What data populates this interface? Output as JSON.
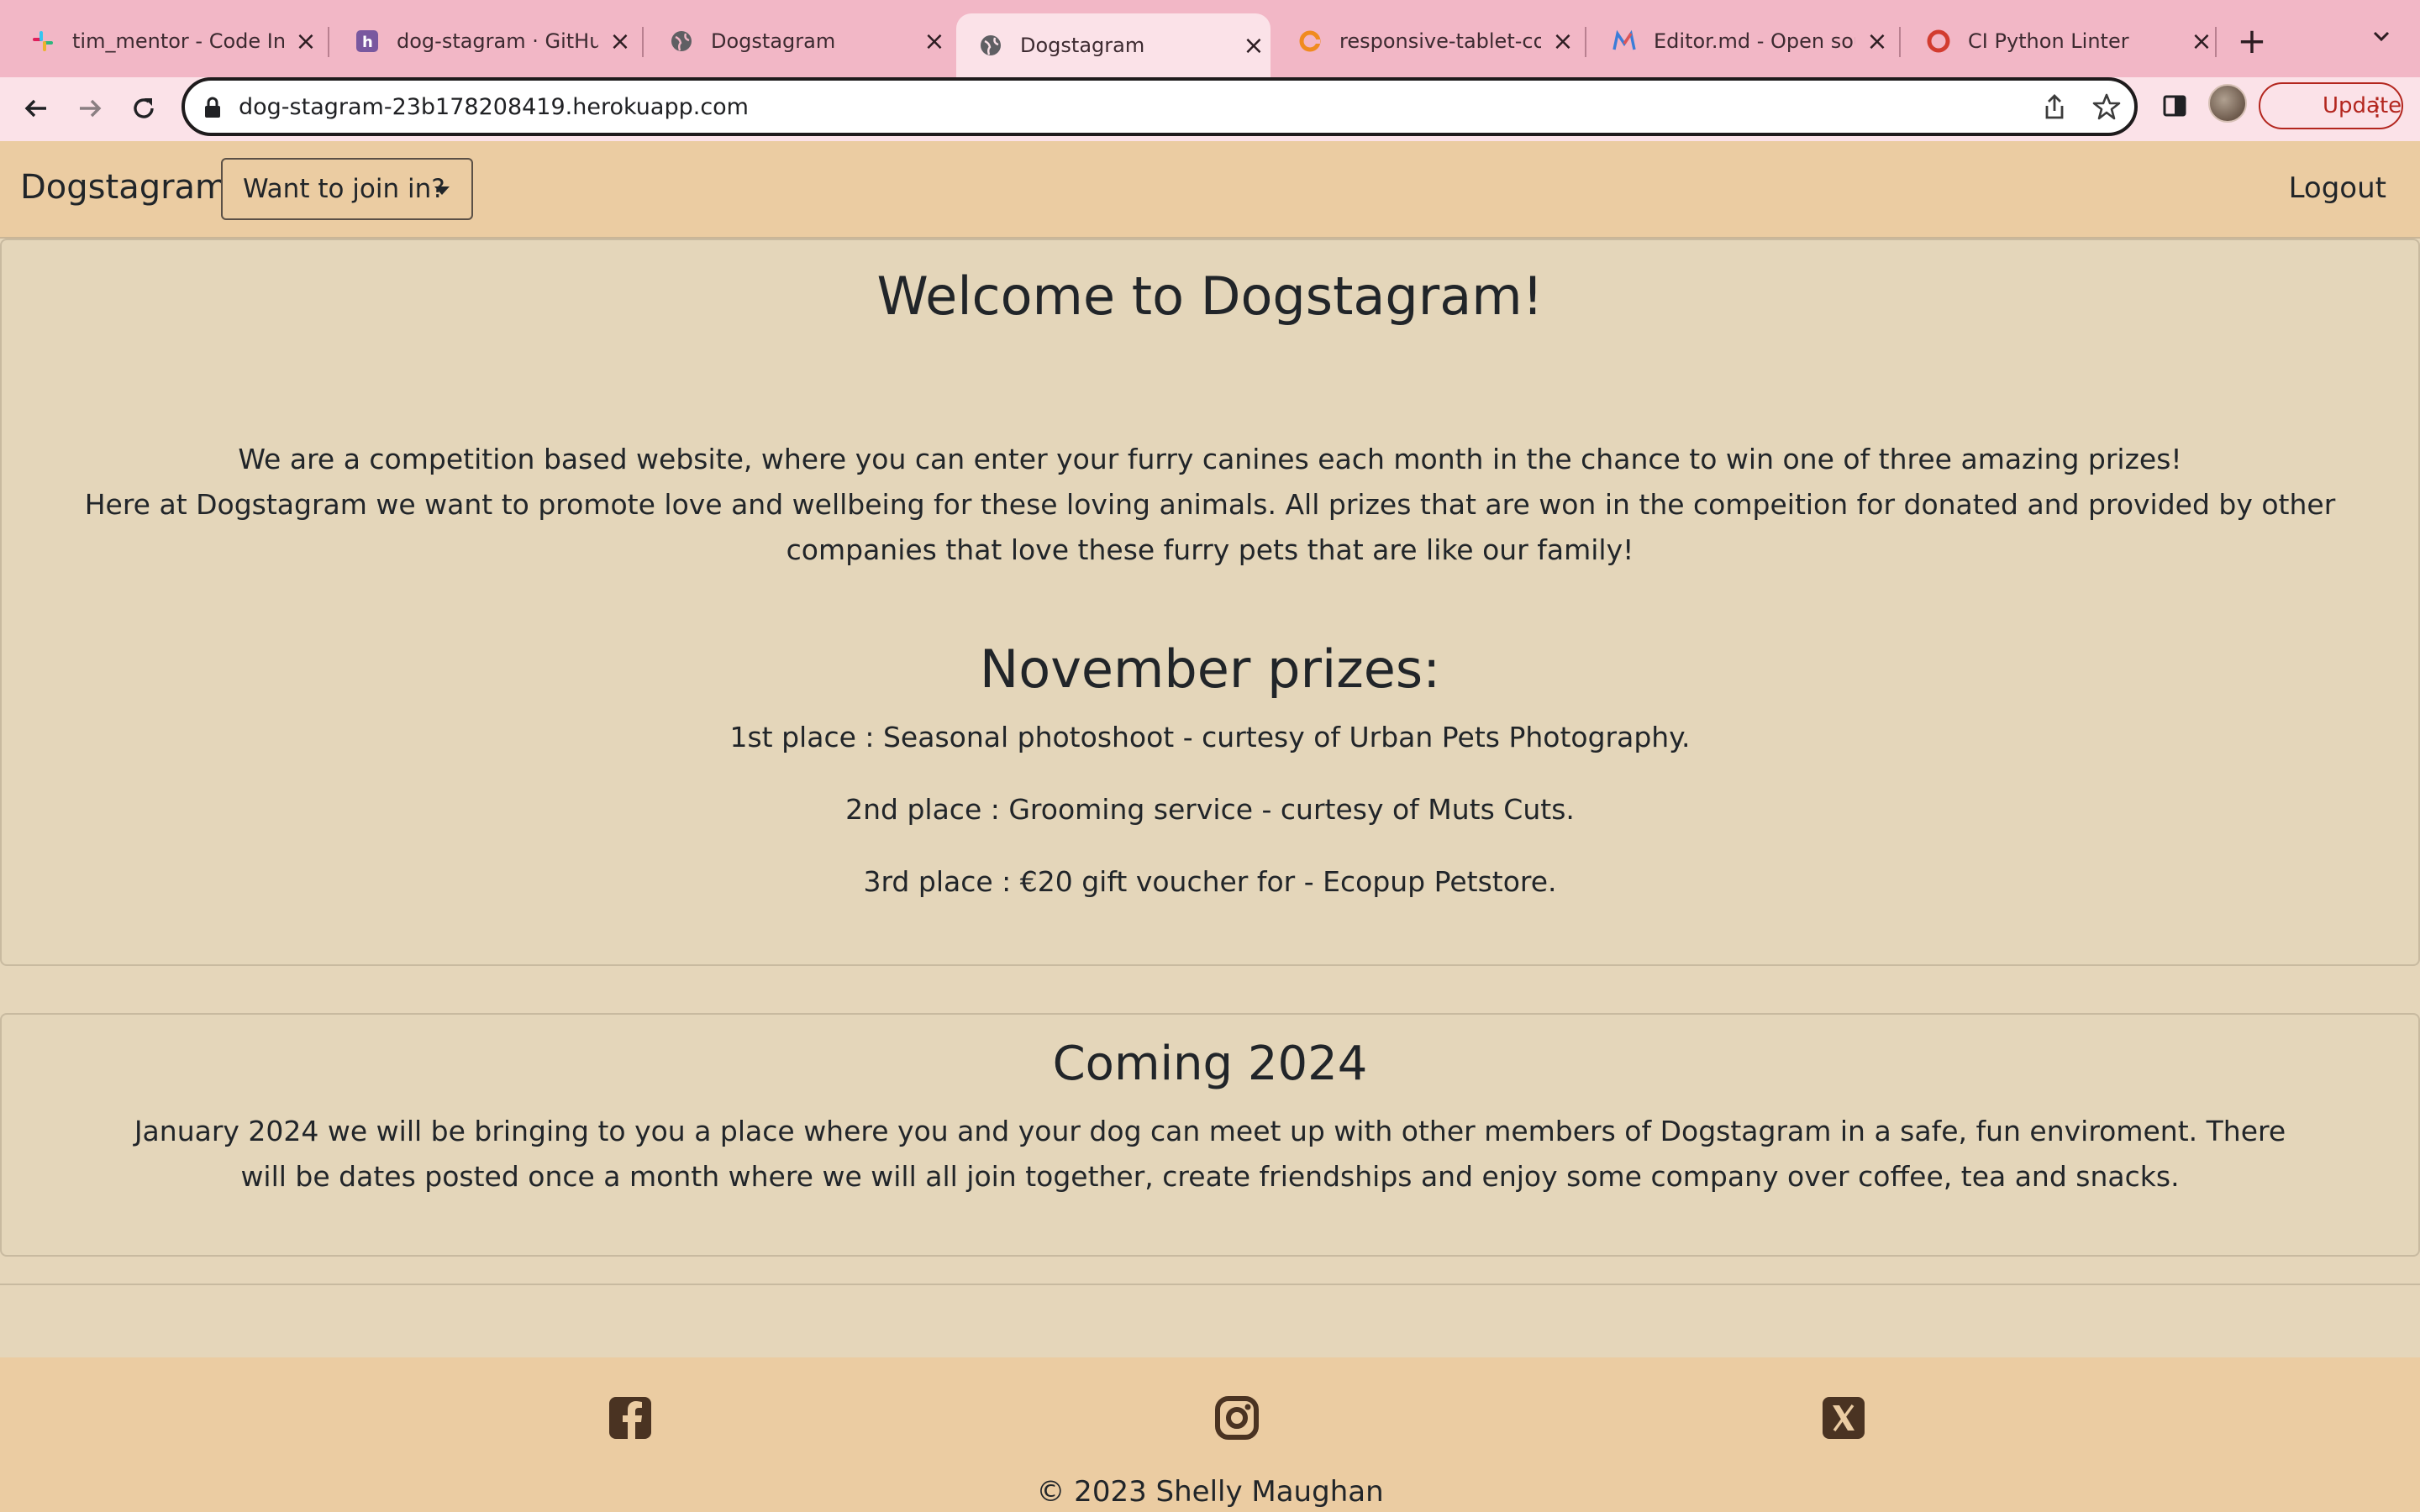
{
  "browser": {
    "tabs": [
      {
        "title": "tim_mentor - Code In",
        "favicon": "slack-icon"
      },
      {
        "title": "dog-stagram · GitHub",
        "favicon": "heroku-icon"
      },
      {
        "title": "Dogstagram",
        "favicon": "globe-icon"
      },
      {
        "title": "Dogstagram",
        "favicon": "globe-icon",
        "active": true
      },
      {
        "title": "responsive-tablet-co",
        "favicon": "reload-ring-icon"
      },
      {
        "title": "Editor.md - Open sou",
        "favicon": "editor-m-icon"
      },
      {
        "title": "CI Python Linter",
        "favicon": "ci-ring-icon"
      }
    ],
    "url": "dog-stagram-23b178208419.herokuapp.com",
    "update_label": "Update",
    "colors": {
      "chrome": "#f2b7c6",
      "toolbar": "#fbe2e8",
      "update": "#b3261e"
    }
  },
  "site": {
    "brand": "Dogstagram",
    "dropdown_label": "Want to join in?",
    "logout_label": "Logout",
    "colors": {
      "navbar": "#ebcca2",
      "body": "#e5d6ba",
      "text": "#212529"
    }
  },
  "welcome": {
    "heading": "Welcome to Dogstagram!",
    "line1": "We are a competition based website, where you can enter your furry canines each month in the chance to win one of three amazing prizes!",
    "line2": "Here at Dogstagram we want to promote love and wellbeing for these loving animals. All prizes that are won in the compeition for donated and provided by other companies that love these furry pets that are like our family!"
  },
  "prizes": {
    "heading": "November prizes:",
    "items": [
      "1st place : Seasonal photoshoot - curtesy of Urban Pets Photography.",
      "2nd place : Grooming service - curtesy of Muts Cuts.",
      "3rd place : €20 gift voucher for - Ecopup Petstore."
    ]
  },
  "coming": {
    "heading": "Coming 2024",
    "text": "January 2024 we will be bringing to you a place where you and your dog can meet up with other members of Dogstagram in a safe, fun enviroment. There will be dates posted once a month where we will all join together, create friendships and enjoy some company over coffee, tea and snacks."
  },
  "footer": {
    "social": [
      "facebook-icon",
      "instagram-icon",
      "x-icon"
    ],
    "copyright": "© 2023 Shelly Maughan"
  }
}
